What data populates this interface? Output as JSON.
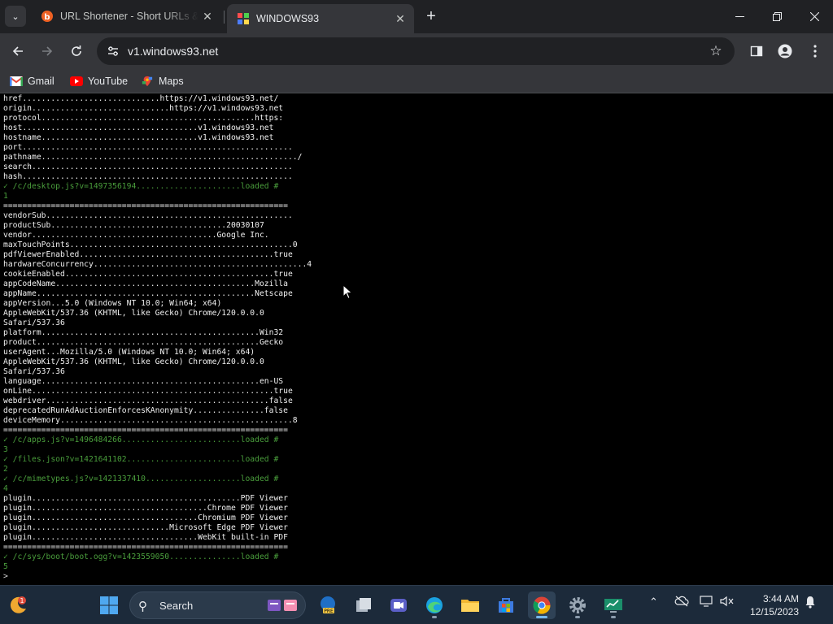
{
  "browser": {
    "tabs": [
      {
        "title": "URL Shortener - Short URLs & Cu",
        "favicon": "bitly-icon",
        "active": false
      },
      {
        "title": "WINDOWS93",
        "favicon": "windows93-icon",
        "active": true
      }
    ],
    "url": "v1.windows93.net",
    "bookmarks": [
      {
        "label": "Gmail",
        "icon": "gmail-icon"
      },
      {
        "label": "YouTube",
        "icon": "youtube-icon"
      },
      {
        "label": "Maps",
        "icon": "maps-icon"
      }
    ]
  },
  "terminal": {
    "lines": [
      {
        "text": "href.............................https://v1.windows93.net/",
        "style": "w"
      },
      {
        "text": "origin.............................https://v1.windows93.net",
        "style": "w"
      },
      {
        "text": "protocol.............................................https:",
        "style": "w"
      },
      {
        "text": "host.....................................v1.windows93.net",
        "style": "w"
      },
      {
        "text": "hostname.................................v1.windows93.net",
        "style": "w"
      },
      {
        "text": "port.........................................................",
        "style": "w"
      },
      {
        "text": "pathname....................................................../",
        "style": "w"
      },
      {
        "text": "search.......................................................",
        "style": "w"
      },
      {
        "text": "hash.........................................................",
        "style": "w"
      },
      {
        "text": "✓ /c/desktop.js?v=1497356194......................loaded #",
        "style": "g"
      },
      {
        "text": "1",
        "style": "g"
      },
      {
        "text": "============================================================",
        "style": "w"
      },
      {
        "text": "vendorSub....................................................",
        "style": "w"
      },
      {
        "text": "productSub.....................................20030107",
        "style": "w"
      },
      {
        "text": "vendor.......................................Google Inc.",
        "style": "w"
      },
      {
        "text": "maxTouchPoints...............................................0",
        "style": "w"
      },
      {
        "text": "pdfViewerEnabled.........................................true",
        "style": "w"
      },
      {
        "text": "hardwareConcurrency.............................................4",
        "style": "w"
      },
      {
        "text": "cookieEnabled............................................true",
        "style": "w"
      },
      {
        "text": "appCodeName..........................................Mozilla",
        "style": "w"
      },
      {
        "text": "appName..............................................Netscape",
        "style": "w"
      },
      {
        "text": "appVersion...5.0 (Windows NT 10.0; Win64; x64)",
        "style": "w"
      },
      {
        "text": "AppleWebKit/537.36 (KHTML, like Gecko) Chrome/120.0.0.0",
        "style": "w"
      },
      {
        "text": "Safari/537.36",
        "style": "w"
      },
      {
        "text": "platform..............................................Win32",
        "style": "w"
      },
      {
        "text": "product...............................................Gecko",
        "style": "w"
      },
      {
        "text": "userAgent...Mozilla/5.0 (Windows NT 10.0; Win64; x64)",
        "style": "w"
      },
      {
        "text": "AppleWebKit/537.36 (KHTML, like Gecko) Chrome/120.0.0.0",
        "style": "w"
      },
      {
        "text": "Safari/537.36",
        "style": "w"
      },
      {
        "text": "language..............................................en-US",
        "style": "w"
      },
      {
        "text": "onLine...................................................true",
        "style": "w"
      },
      {
        "text": "webdriver...............................................false",
        "style": "w"
      },
      {
        "text": "deprecatedRunAdAuctionEnforcesKAnonymity...............false",
        "style": "w"
      },
      {
        "text": "deviceMemory.................................................8",
        "style": "w"
      },
      {
        "text": "============================================================",
        "style": "w"
      },
      {
        "text": "✓ /c/apps.js?v=1496484266.........................loaded #",
        "style": "g"
      },
      {
        "text": "3",
        "style": "g"
      },
      {
        "text": "✓ /files.json?v=1421641102........................loaded #",
        "style": "g"
      },
      {
        "text": "2",
        "style": "g"
      },
      {
        "text": "✓ /c/mimetypes.js?v=1421337410....................loaded #",
        "style": "g"
      },
      {
        "text": "4",
        "style": "g"
      },
      {
        "text": "plugin............................................PDF Viewer",
        "style": "w"
      },
      {
        "text": "plugin.....................................Chrome PDF Viewer",
        "style": "w"
      },
      {
        "text": "plugin...................................Chromium PDF Viewer",
        "style": "w"
      },
      {
        "text": "plugin.............................Microsoft Edge PDF Viewer",
        "style": "w"
      },
      {
        "text": "plugin...................................WebKit built-in PDF",
        "style": "w"
      },
      {
        "text": "============================================================",
        "style": "w"
      },
      {
        "text": "✓ /c/sys/boot/boot.ogg?v=1423559050...............loaded #",
        "style": "g"
      },
      {
        "text": "5",
        "style": "g"
      },
      {
        "text": ">",
        "style": "d"
      }
    ]
  },
  "taskbar": {
    "search_label": "Search",
    "start_badge": "1",
    "apps": [
      {
        "name": "xbox-pre-app",
        "running": false
      },
      {
        "name": "task-view",
        "running": false
      },
      {
        "name": "meet-app",
        "running": false
      },
      {
        "name": "edge-browser",
        "running": true
      },
      {
        "name": "file-explorer",
        "running": false
      },
      {
        "name": "microsoft-store",
        "running": false
      },
      {
        "name": "chrome-browser",
        "running": true
      },
      {
        "name": "settings-app",
        "running": true
      },
      {
        "name": "terminal-app",
        "running": true
      }
    ],
    "time": "3:44 AM",
    "date": "12/15/2023"
  }
}
